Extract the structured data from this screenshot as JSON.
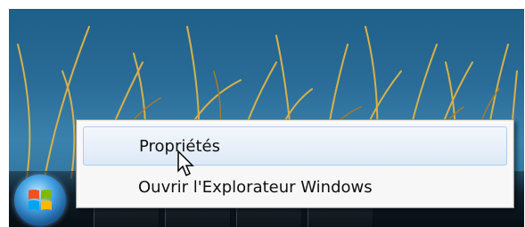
{
  "context_menu": {
    "items": [
      {
        "label": "Propriétés",
        "highlighted": true
      },
      {
        "label": "Ouvrir l'Explorateur Windows",
        "highlighted": false
      }
    ]
  },
  "taskbar": {
    "start_button_icon": "windows-start-orb-icon",
    "pinned_icons": [
      "internet-explorer-icon",
      "windows-explorer-icon",
      "media-player-icon",
      "network-icon"
    ]
  },
  "colors": {
    "menu_background": "#f7f7f7",
    "highlight_border": "#aecbee",
    "desktop_blue": "#2a6d98"
  }
}
